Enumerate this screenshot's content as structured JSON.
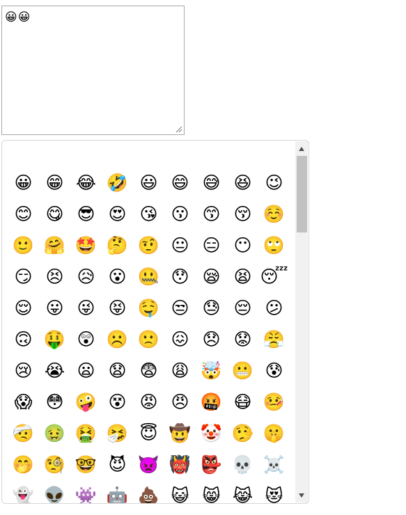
{
  "textarea": {
    "value": "😀😀"
  },
  "picker": {
    "emojis": [
      "😀",
      "😁",
      "😂",
      "🤣",
      "😃",
      "😄",
      "😅",
      "😆",
      "😉",
      "😊",
      "😋",
      "😎",
      "😍",
      "😘",
      "😗",
      "😙",
      "😚",
      "☺️",
      "🙂",
      "🤗",
      "🤩",
      "🤔",
      "🤨",
      "😐",
      "😑",
      "😶",
      "🙄",
      "😏",
      "😣",
      "😥",
      "😮",
      "🤐",
      "😯",
      "😪",
      "😫",
      "😴",
      "😌",
      "😛",
      "😜",
      "😝",
      "🤤",
      "😒",
      "😓",
      "😔",
      "😕",
      "🙃",
      "🤑",
      "😲",
      "☹️",
      "🙁",
      "😖",
      "😞",
      "😟",
      "😤",
      "😢",
      "😭",
      "😦",
      "😧",
      "😨",
      "😩",
      "🤯",
      "😬",
      "😰",
      "😱",
      "😳",
      "🤪",
      "😵",
      "😡",
      "😠",
      "🤬",
      "😷",
      "🤒",
      "🤕",
      "🤢",
      "🤮",
      "🤧",
      "😇",
      "🤠",
      "🤡",
      "🤥",
      "🤫",
      "🤭",
      "🧐",
      "🤓",
      "😈",
      "👿",
      "👹",
      "👺",
      "💀",
      "☠️",
      "👻",
      "👽",
      "👾",
      "🤖",
      "💩",
      "😺",
      "😸",
      "😹",
      "😻"
    ],
    "scrollbar": {
      "up_arrow_icon": "triangle-up",
      "down_arrow_icon": "triangle-down",
      "thumb_color": "#c1c1c1",
      "track_color": "#f1f1f1"
    }
  }
}
